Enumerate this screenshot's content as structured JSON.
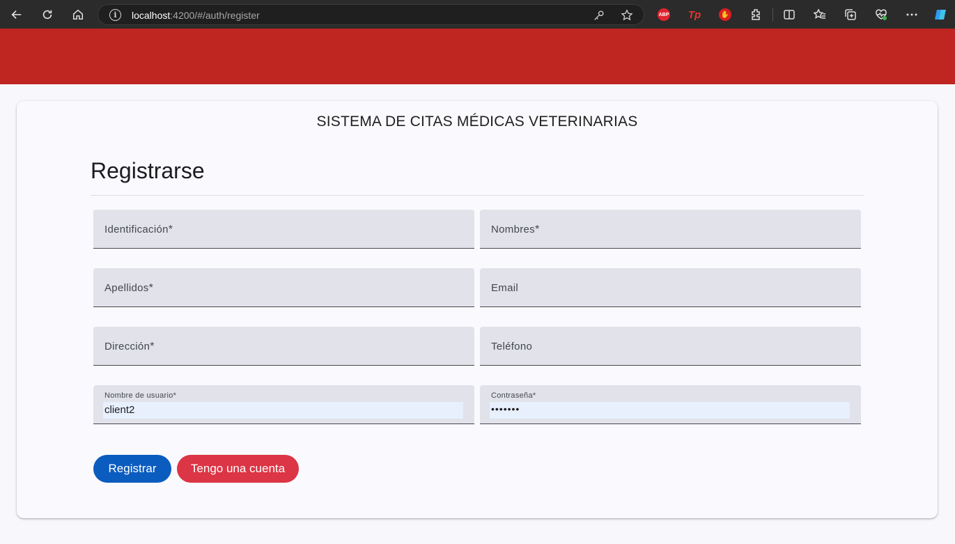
{
  "browser": {
    "url_host": "localhost",
    "url_rest": ":4200/#/auth/register",
    "ext_abp": "ABP",
    "ext_tp": "Tp"
  },
  "card": {
    "system_title": "SISTEMA DE CITAS MÉDICAS VETERINARIAS",
    "form_title": "Registrarse"
  },
  "fields": {
    "identificacion": {
      "label": "Identificación",
      "required": "*"
    },
    "nombres": {
      "label": "Nombres",
      "required": "*"
    },
    "apellidos": {
      "label": "Apellidos",
      "required": "*"
    },
    "email": {
      "label": "Email"
    },
    "direccion": {
      "label": "Dirección",
      "required": "*"
    },
    "telefono": {
      "label": "Teléfono"
    },
    "usuario": {
      "label": "Nombre de usuario",
      "required": "*",
      "value": "client2"
    },
    "contrasena": {
      "label": "Contraseña",
      "required": "*",
      "value": "•••••••"
    }
  },
  "buttons": {
    "register": "Registrar",
    "have_account": "Tengo una cuenta"
  },
  "colors": {
    "header": "#bf2521",
    "primary": "#0b5cbf",
    "secondary": "#dc3545"
  }
}
